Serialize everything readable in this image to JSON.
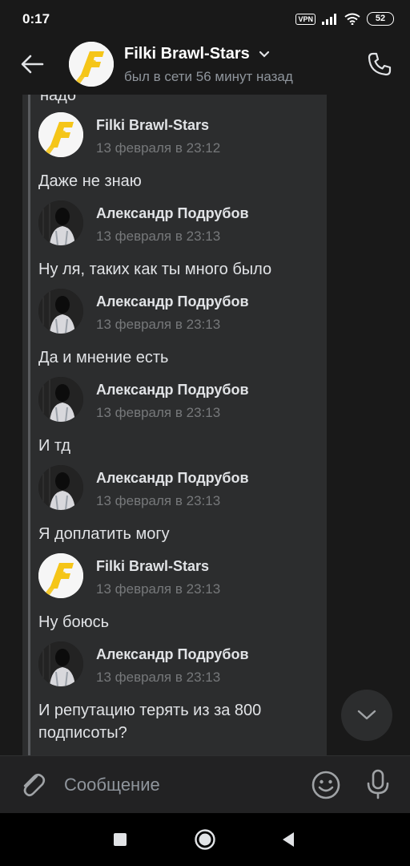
{
  "status_bar": {
    "time": "0:17",
    "vpn": "VPN",
    "battery": "52"
  },
  "header": {
    "title": "Filki Brawl-Stars",
    "subtitle": "был в сети 56 минут назад"
  },
  "chat": {
    "cut_off_text": "надо",
    "messages": [
      {
        "author": "Filki Brawl-Stars",
        "date": "13 февраля в 23:12",
        "text": "Даже не знаю",
        "avatar": "filki-logo"
      },
      {
        "author": "Александр Подрубов",
        "date": "13 февраля в 23:13",
        "text": "Ну ля, таких как ты много было",
        "avatar": "alexander-photo"
      },
      {
        "author": "Александр Подрубов",
        "date": "13 февраля в 23:13",
        "text": "Да и мнение есть",
        "avatar": "alexander-photo"
      },
      {
        "author": "Александр Подрубов",
        "date": "13 февраля в 23:13",
        "text": "И тд",
        "avatar": "alexander-photo"
      },
      {
        "author": "Александр Подрубов",
        "date": "13 февраля в 23:13",
        "text": "Я доплатить могу",
        "avatar": "alexander-photo"
      },
      {
        "author": "Filki Brawl-Stars",
        "date": "13 февраля в 23:13",
        "text": "Ну боюсь",
        "avatar": "filki-logo"
      },
      {
        "author": "Александр Подрубов",
        "date": "13 февраля в 23:13",
        "text": "И репутацию терять из за 800 подписоты?",
        "avatar": "alexander-photo"
      }
    ]
  },
  "composer": {
    "placeholder": "Сообщение"
  },
  "colors": {
    "background": "#191919",
    "bubble": "#2c2d2e",
    "logo_yellow": "#f5c518",
    "secondary_text": "#8f959c"
  },
  "icons": [
    "back-arrow-icon",
    "chevron-down-icon",
    "phone-icon",
    "paperclip-icon",
    "emoji-icon",
    "microphone-icon",
    "scroll-down-chevron-icon",
    "nav-recents-icon",
    "nav-home-icon",
    "nav-back-icon"
  ]
}
